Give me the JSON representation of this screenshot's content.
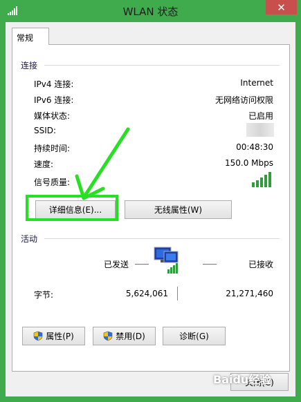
{
  "window": {
    "title": "WLAN 状态",
    "close_glyph": "✕",
    "accent": "#3fab4c",
    "close_color": "#c7504c"
  },
  "tabs": [
    {
      "label": "常规",
      "selected": true
    }
  ],
  "connection": {
    "section_label": "连接",
    "rows": [
      {
        "label": "IPv4 连接:",
        "value": "Internet"
      },
      {
        "label": "IPv6 连接:",
        "value": "无网络访问权限"
      },
      {
        "label": "媒体状态:",
        "value": "已启用"
      },
      {
        "label": "SSID:",
        "value": ""
      },
      {
        "label": "持续时间:",
        "value": "00:48:30"
      },
      {
        "label": "速度:",
        "value": "150.0 Mbps"
      }
    ],
    "signal_label": "信号质量:",
    "signal_bars": 5,
    "signal_bars_max": 5,
    "details_button": "详细信息(E)...",
    "wireless_props_button": "无线属性(W)"
  },
  "activity": {
    "section_label": "活动",
    "sent_label": "已发送",
    "received_label": "已接收",
    "bytes_label": "字节:",
    "bytes_sent": "5,624,061",
    "bytes_received": "21,271,460"
  },
  "actions": {
    "properties_button": "属性(P)",
    "disable_button": "禁用(D)",
    "diagnose_button": "诊断(G)"
  },
  "footer": {
    "close_button": "关闭(C)",
    "watermark": "Baidu经验"
  },
  "annotation_color": "#27e024"
}
